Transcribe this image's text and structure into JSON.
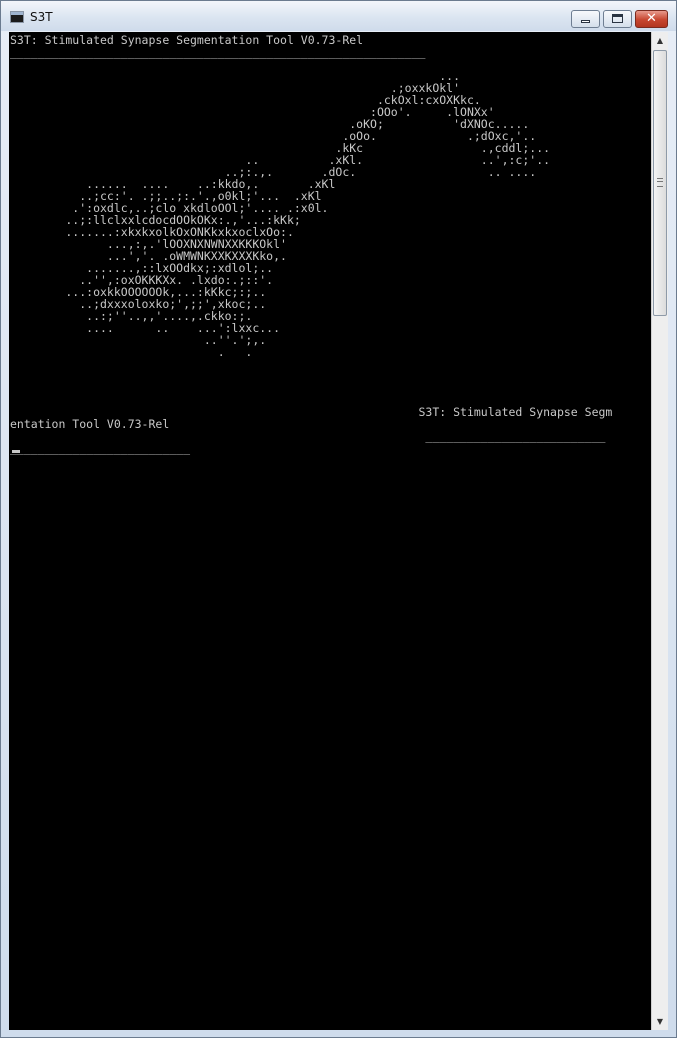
{
  "window": {
    "title": "S3T",
    "icon": "console-app-icon",
    "controls": {
      "minimize_icon": "minimize-icon",
      "maximize_icon": "maximize-icon",
      "close_icon": "close-icon",
      "close_glyph": "✕"
    }
  },
  "console": {
    "background": "#000000",
    "foreground": "#c8c8c8",
    "output_text": "S3T: Stimulated Synapse Segmentation Tool V0.73-Rel\n____________________________________________________________\n\n                                                              ...\n                                                       .;oxxkOkl'\n                                                     .ckOxl:cxOXKkc.\n                                                    :OOo'.     .lONXx'\n                                                 .oKO;          'dXNOc.....\n                                                .oOo.             .;dOxc,'..\n                                               .kKc                 .,cddl;...\n                                  ..          .xKl.                 ..',:c;'..\n                               ..;:.,.       .dOc.                   .. ....\n           ......  ....    ..:kkdo,.       .xKl\n          ..;cc:'. .;;..;:.'.,o0kl;'...  .xKl\n         .':oxdlc,..;clo xkdloOOl;'.... .:x0l.\n        ..;:llclxxlcdocdOOkOKx:.,'...:kKk;\n        .......:xkxkxolkOxONKkxkxoclxOo:.\n              ...,:,.'lOOXNXNWNXXKKKOkl'\n              ...','. .oWMWNKXXKXXXKko,.\n           .......,::lxOOdkx;:xdlol;..\n          ..'',:oxOKKKXx. .lxdo:.;::'.\n        ...:oxkkOOOOOOk,...:kKkc;:;..\n          ..;dxxxoloxko;',;;',xkoc;..\n           ..:;''..,,'....,.ckko:;.\n           ....      ..    ...':lxxc...\n                            ..''.';,.\n                              .   .\n\n\n\n\n                                                           S3T: Stimulated Synapse Segm\nentation Tool V0.73-Rel\n                                                            __________________________\n__________________________"
  }
}
